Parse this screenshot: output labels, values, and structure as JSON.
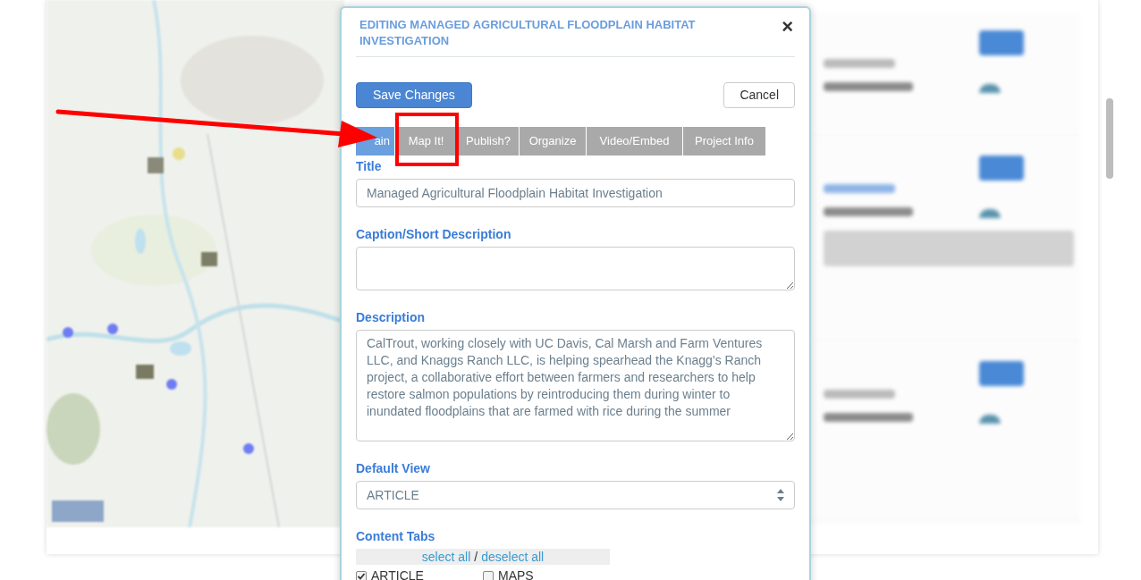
{
  "dialog": {
    "title": "EDITING MANAGED AGRICULTURAL FLOODPLAIN HABITAT INVESTIGATION",
    "close": "×",
    "buttons": {
      "save": "Save Changes",
      "cancel": "Cancel"
    },
    "tabs": [
      {
        "label": "ain",
        "selected": true
      },
      {
        "label": "Map It!",
        "selected": false
      },
      {
        "label": "Publish?",
        "selected": false
      },
      {
        "label": "Organize",
        "selected": false
      },
      {
        "label": "Video/Embed",
        "selected": false
      },
      {
        "label": "Project Info",
        "selected": false
      }
    ],
    "fields": [
      {
        "kind": "input",
        "label": "Title",
        "value": "Managed Agricultural Floodplain Habitat Investigation"
      },
      {
        "kind": "textarea",
        "label": "Caption/Short Description"
      },
      {
        "kind": "textarea",
        "label": "Description",
        "value": "CalTrout, working closely with UC Davis, Cal Marsh and Farm Ventures LLC, and Knaggs Ranch LLC, is helping spearhead the Knagg’s Ranch project, a collaborative effort between farmers and researchers to help restore salmon populations by reintroducing them during winter to inundated floodplains that are farmed with rice during the summer"
      },
      {
        "kind": "select",
        "label": "Default View",
        "value": "ARTICLE"
      }
    ],
    "content_tabs": {
      "label": "Content Tabs",
      "select_all": "select all",
      "separator": "/",
      "deselect_all": "deselect all",
      "options": [
        {
          "label": "ARTICLE",
          "checked": true
        },
        {
          "label": "MAPS",
          "checked": false
        }
      ]
    }
  }
}
